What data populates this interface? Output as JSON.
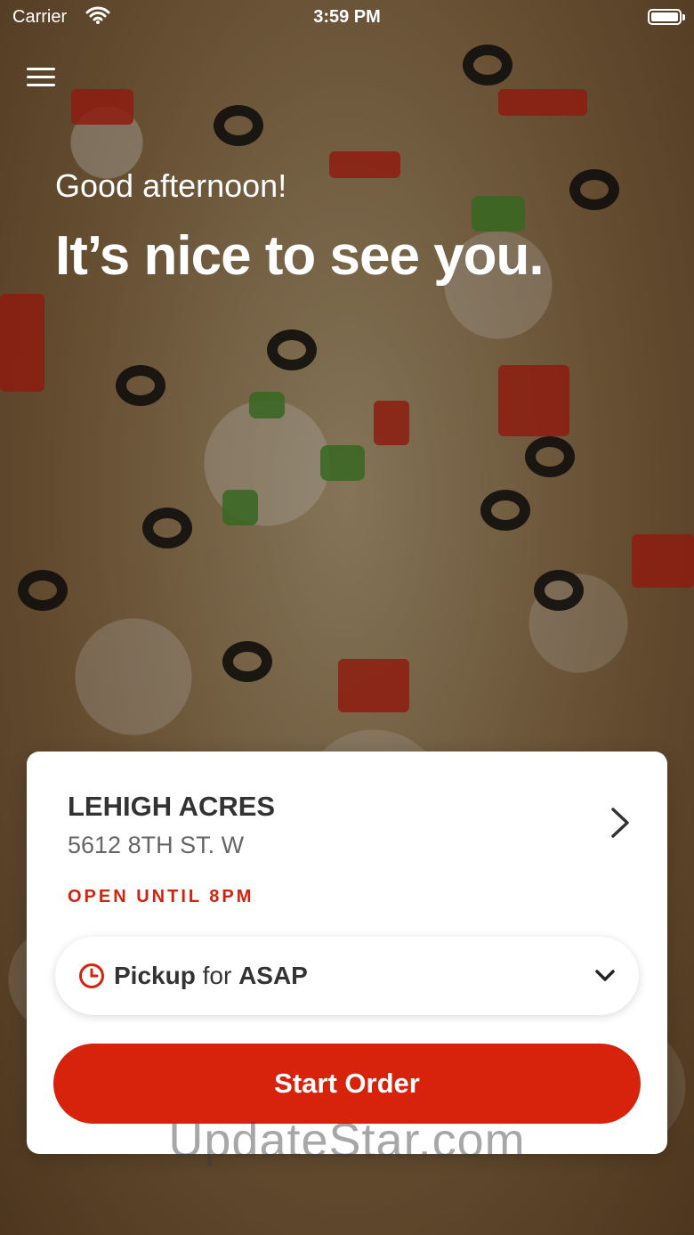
{
  "status_bar": {
    "carrier": "Carrier",
    "time": "3:59 PM"
  },
  "hero": {
    "greeting": "Good afternoon!",
    "headline": "It’s nice to see you."
  },
  "location": {
    "name": "LEHIGH ACRES",
    "address": "5612 8TH ST. W",
    "hours": "OPEN UNTIL 8PM"
  },
  "order_mode": {
    "mode": "Pickup",
    "connector": "for",
    "time": "ASAP"
  },
  "actions": {
    "start_order": "Start Order"
  },
  "watermark": "UpdateStar.com",
  "colors": {
    "accent": "#d7220c",
    "hours_text": "#d4220e"
  },
  "icons": [
    "wifi-icon",
    "battery-icon",
    "menu-icon",
    "chevron-right-icon",
    "clock-icon",
    "chevron-down-icon"
  ]
}
